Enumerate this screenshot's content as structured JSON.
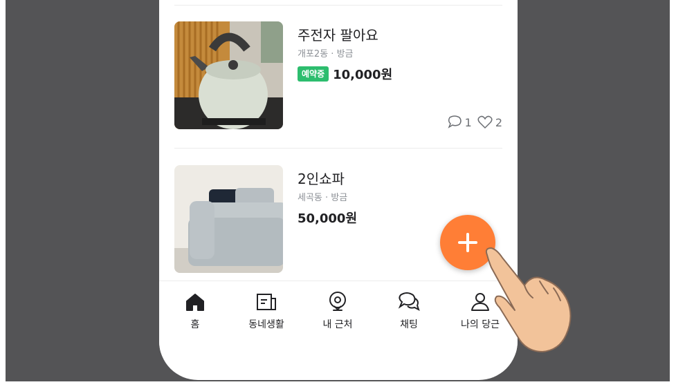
{
  "listings": [
    {
      "title": "주전자 팔아요",
      "location": "개포2동",
      "time": "방금",
      "badge": "예약중",
      "price": "10,000원",
      "chat_count": "1",
      "like_count": "2",
      "image_icon": "kettle-photo"
    },
    {
      "title": "2인쇼파",
      "location": "세곡동",
      "time": "방금",
      "price": "50,000원",
      "image_icon": "sofa-photo"
    }
  ],
  "nav": {
    "items": [
      {
        "label": "홈",
        "icon": "home-icon",
        "active": true
      },
      {
        "label": "동네생활",
        "icon": "newspaper-icon"
      },
      {
        "label": "내 근처",
        "icon": "location-pin-icon"
      },
      {
        "label": "채팅",
        "icon": "chat-bubbles-icon"
      },
      {
        "label": "나의 당근",
        "icon": "person-icon"
      }
    ]
  },
  "fab": {
    "icon": "plus-icon"
  },
  "colors": {
    "accent": "#ff7e36",
    "badge_green": "#2dbd6e",
    "backdrop": "#545456",
    "text": "#212124",
    "muted": "#8b8f95"
  }
}
